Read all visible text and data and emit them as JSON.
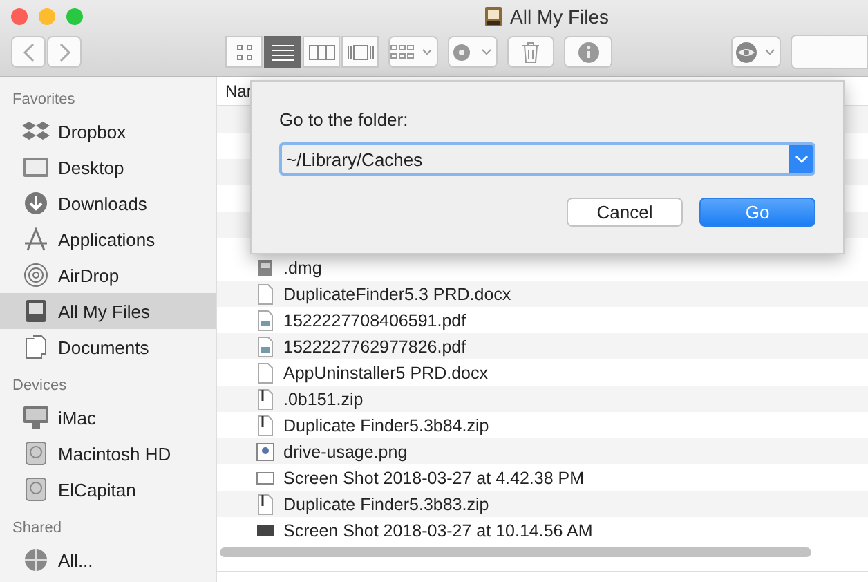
{
  "window": {
    "title": "All My Files"
  },
  "toolbar": {
    "views": [
      {
        "kind": "icons",
        "selected": false
      },
      {
        "kind": "list",
        "selected": true
      },
      {
        "kind": "columns",
        "selected": false
      },
      {
        "kind": "cover",
        "selected": false
      }
    ]
  },
  "sidebar": {
    "sections": [
      {
        "title": "Favorites",
        "items": [
          {
            "label": "Dropbox",
            "kind": "dropbox",
            "selected": false
          },
          {
            "label": "Desktop",
            "kind": "desktop",
            "selected": false
          },
          {
            "label": "Downloads",
            "kind": "downloads",
            "selected": false
          },
          {
            "label": "Applications",
            "kind": "apps",
            "selected": false
          },
          {
            "label": "AirDrop",
            "kind": "airdrop",
            "selected": false
          },
          {
            "label": "All My Files",
            "kind": "allfiles",
            "selected": true
          },
          {
            "label": "Documents",
            "kind": "docs",
            "selected": false
          }
        ]
      },
      {
        "title": "Devices",
        "items": [
          {
            "label": "iMac",
            "kind": "imac",
            "selected": false
          },
          {
            "label": "Macintosh HD",
            "kind": "disk",
            "selected": false
          },
          {
            "label": "ElCapitan",
            "kind": "disk",
            "selected": false
          }
        ]
      },
      {
        "title": "Shared",
        "items": [
          {
            "label": "All...",
            "kind": "network",
            "selected": false
          }
        ]
      }
    ]
  },
  "table": {
    "columns": [
      "Nar"
    ],
    "rows": [
      {
        "name": ".dmg",
        "kind": "dmg"
      },
      {
        "name": "DuplicateFinder5.3 PRD.docx",
        "kind": "doc"
      },
      {
        "name": "1522227708406591.pdf",
        "kind": "pdf"
      },
      {
        "name": "1522227762977826.pdf",
        "kind": "pdf"
      },
      {
        "name": "AppUninstaller5 PRD.docx",
        "kind": "doc"
      },
      {
        "name": ".0b151.zip",
        "kind": "zip"
      },
      {
        "name": "Duplicate Finder5.3b84.zip",
        "kind": "zip"
      },
      {
        "name": "drive-usage.png",
        "kind": "png"
      },
      {
        "name": "Screen Shot 2018-03-27 at 4.42.38 PM",
        "kind": "shot"
      },
      {
        "name": "Duplicate Finder5.3b83.zip",
        "kind": "zip"
      },
      {
        "name": "Screen Shot 2018-03-27 at 10.14.56 AM",
        "kind": "shotdark"
      }
    ]
  },
  "dialog": {
    "label": "Go to the folder:",
    "value": "~/Library/Caches",
    "buttons": [
      {
        "label": "Cancel",
        "kind": "secondary"
      },
      {
        "label": "Go",
        "kind": "primary"
      }
    ]
  }
}
